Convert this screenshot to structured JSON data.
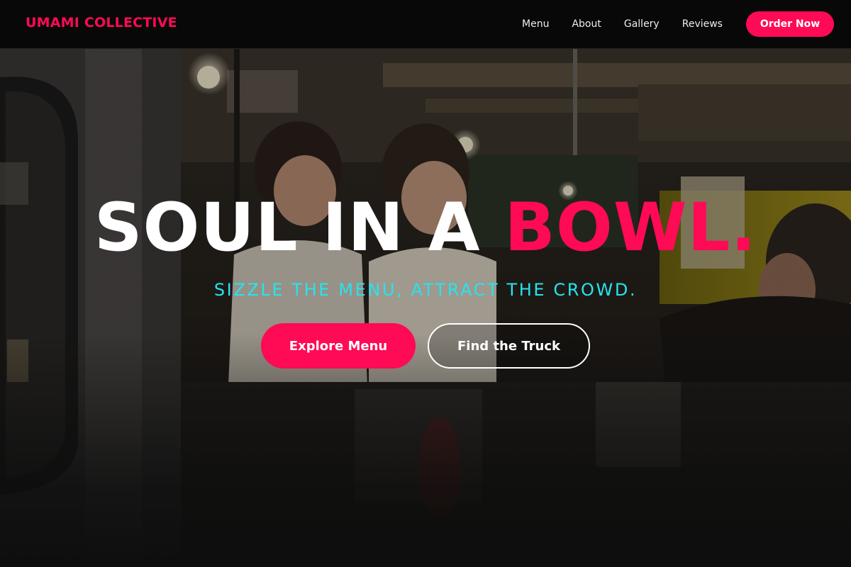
{
  "nav": {
    "brand": "UMAMI COLLECTIVE",
    "links": [
      {
        "label": "Menu"
      },
      {
        "label": "About"
      },
      {
        "label": "Gallery"
      },
      {
        "label": "Reviews"
      }
    ],
    "cta_label": "Order Now"
  },
  "hero": {
    "title_main": "SOUL IN A ",
    "title_accent": "BOWL.",
    "subtitle": "SIZZLE THE MENU, ATTRACT THE CROWD.",
    "primary_cta": "Explore Menu",
    "secondary_cta": "Find the Truck",
    "background_image": "food-truck-workers-photo"
  },
  "colors": {
    "accent": "#ff0a55",
    "subtitle": "#26e4ee",
    "nav_bg": "#080808",
    "text": "#ffffff"
  }
}
